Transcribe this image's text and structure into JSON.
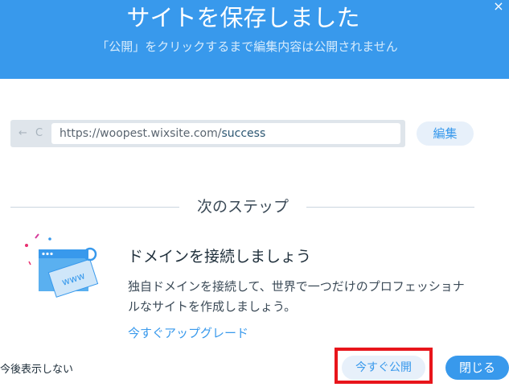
{
  "header": {
    "title": "サイトを保存しました",
    "subtitle": "「公開」をクリックするまで編集内容は公開されません",
    "close_glyph": "×"
  },
  "url_bar": {
    "nav_glyphs": "← C",
    "url_base": "https://woopest.wixsite.com/",
    "url_path": "success",
    "edit_label": "編集"
  },
  "next_steps": {
    "heading": "次のステップ",
    "domain_title": "ドメインを接続しましょう",
    "domain_description": "独自ドメインを接続して、世界で一つだけのプロフェッショナルなサイトを作成しましょう。",
    "upgrade_link": "今すぐアップグレード",
    "illustration_text": "www"
  },
  "footer": {
    "dont_show_label": "今後表示しない",
    "publish_label": "今すぐ公開",
    "close_label": "閉じる"
  },
  "colors": {
    "brand_blue": "#3899ec",
    "highlight_red": "#e8151b",
    "light_button": "#e7f0fa"
  }
}
